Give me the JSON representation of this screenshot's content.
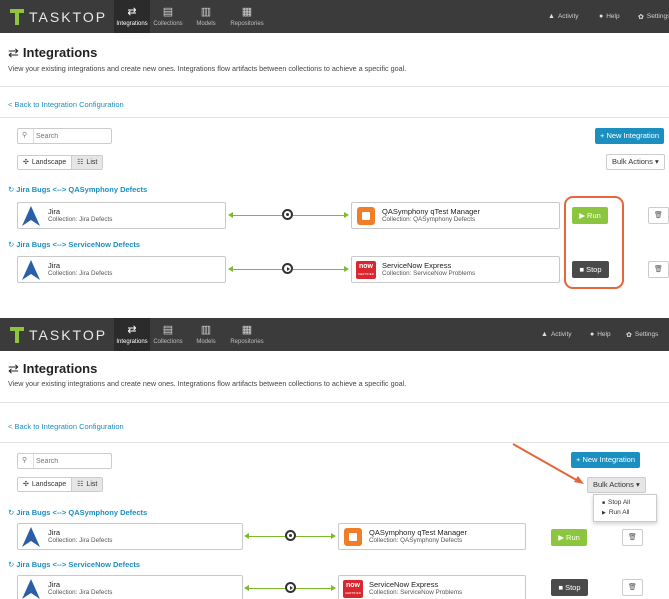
{
  "app": {
    "logo_text": "TASKTOP",
    "nav": [
      {
        "label": "Integrations",
        "icon": "⇄",
        "active": true
      },
      {
        "label": "Collections",
        "icon": "▤",
        "active": false
      },
      {
        "label": "Models",
        "icon": "▥",
        "active": false
      },
      {
        "label": "Repositories",
        "icon": "▦",
        "active": false
      }
    ],
    "top_right": [
      {
        "label": "Activity",
        "icon": "bell-icon",
        "glyph": "▲"
      },
      {
        "label": "Help",
        "icon": "help-icon",
        "glyph": "●"
      },
      {
        "label": "Settings",
        "icon": "gear-icon",
        "glyph": "✿"
      }
    ]
  },
  "header": {
    "title": "Integrations",
    "title_icon": "⇄",
    "subtitle": "View your existing integrations and create new ones. Integrations flow artifacts between collections to achieve a specific goal."
  },
  "back_link": "< Back to Integration Configuration",
  "search": {
    "placeholder": "Search",
    "icon": "search-icon"
  },
  "view_toggle": {
    "landscape": "Landscape",
    "list": "List"
  },
  "actions": {
    "new_integration": "+ New Integration",
    "bulk_actions": "Bulk Actions"
  },
  "bulk_menu": [
    "Stop All",
    "Run All"
  ],
  "integrations": [
    {
      "name": "Jira Bugs <--> QASymphony Defects",
      "left": {
        "repo": "Jira",
        "collection": "Collection: Jira Defects"
      },
      "right": {
        "repo": "QASymphony qTest Manager",
        "collection": "Collection: QASymphony Defects"
      },
      "state_icon": "stop",
      "action": "▶ Run"
    },
    {
      "name": "Jira Bugs <--> ServiceNow Defects",
      "left": {
        "repo": "Jira",
        "collection": "Collection: Jira Defects"
      },
      "right": {
        "repo": "ServiceNow Express",
        "collection": "Collection: ServiceNow Problems"
      },
      "state_icon": "play",
      "action": "■ Stop"
    }
  ],
  "servicenow_logo": {
    "word": "now",
    "tag": "CERTIFIED"
  },
  "colors": {
    "topbar": "#3b3b3b",
    "accent": "#1a8fc0",
    "run": "#8cc63f",
    "stop": "#4a4a4a",
    "flow": "#7dbb2b",
    "annotation": "#e4663a"
  }
}
